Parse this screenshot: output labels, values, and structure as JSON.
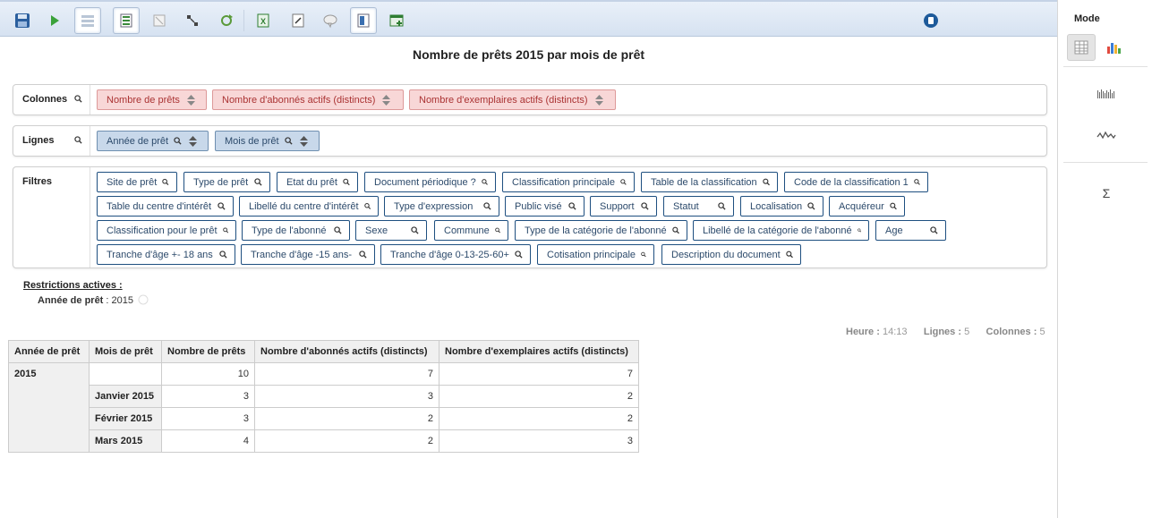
{
  "toolbar": {
    "icons": [
      "save-icon",
      "run-icon",
      "toggle-fields-icon",
      "hierarchy-icon",
      "non-empty-icon",
      "swap-axes-icon",
      "refresh-icon",
      "excel-export-icon",
      "mdx-icon",
      "comment-icon",
      "report-settings-icon",
      "new-query-icon",
      "trash-icon"
    ]
  },
  "mode": {
    "title": "Mode",
    "options": [
      "table-mode-icon",
      "chart-mode-icon",
      "bar-chart-icon",
      "line-chart-icon",
      "sum-icon"
    ],
    "sum_symbol": "Σ"
  },
  "report": {
    "title": "Nombre de prêts 2015 par mois de prêt"
  },
  "columns_panel": {
    "label": "Colonnes",
    "items": [
      "Nombre de prêts",
      "Nombre d'abonnés actifs (distincts)",
      "Nombre d'exemplaires actifs (distincts)"
    ]
  },
  "rows_panel": {
    "label": "Lignes",
    "items": [
      "Année de prêt",
      "Mois de prêt"
    ]
  },
  "filters_panel": {
    "label": "Filtres",
    "row1": [
      "Site de prêt",
      "Type de prêt",
      "Etat du prêt",
      "Document périodique ?",
      "Classification principale",
      "Table de la classification",
      "Code de la classification 1"
    ],
    "row2": [
      "Table du centre d'intérêt",
      "Libellé du centre d'intérêt",
      "Type d'expression",
      "Public visé",
      "Support",
      "Statut",
      "Localisation",
      "Acquéreur"
    ],
    "row3": [
      "Classification pour le prêt",
      "Type de l'abonné",
      "Sexe",
      "Commune",
      "Type de la catégorie de l'abonné",
      "Libellé de la catégorie de l'abonné",
      "Age"
    ],
    "row4": [
      "Tranche d'âge +- 18 ans",
      "Tranche d'âge -15 ans-",
      "Tranche d'âge 0-13-25-60+",
      "Cotisation principale",
      "Description du document"
    ]
  },
  "restrictions": {
    "title": "Restrictions actives :",
    "field": "Année de prêt",
    "separator": " : ",
    "value": "2015"
  },
  "status": {
    "time_label": "Heure :",
    "time_value": "14:13",
    "rows_label": "Lignes :",
    "rows_value": "5",
    "cols_label": "Colonnes :",
    "cols_value": "5"
  },
  "table": {
    "headers": [
      "Année de prêt",
      "Mois de prêt",
      "Nombre de prêts",
      "Nombre d'abonnés actifs (distincts)",
      "Nombre d'exemplaires actifs (distincts)"
    ],
    "year": "2015",
    "rows": [
      {
        "month": "",
        "loans": "10",
        "members": "7",
        "copies": "7"
      },
      {
        "month": "Janvier 2015",
        "loans": "3",
        "members": "3",
        "copies": "2"
      },
      {
        "month": "Février 2015",
        "loans": "3",
        "members": "2",
        "copies": "2"
      },
      {
        "month": "Mars 2015",
        "loans": "4",
        "members": "2",
        "copies": "3"
      }
    ]
  }
}
